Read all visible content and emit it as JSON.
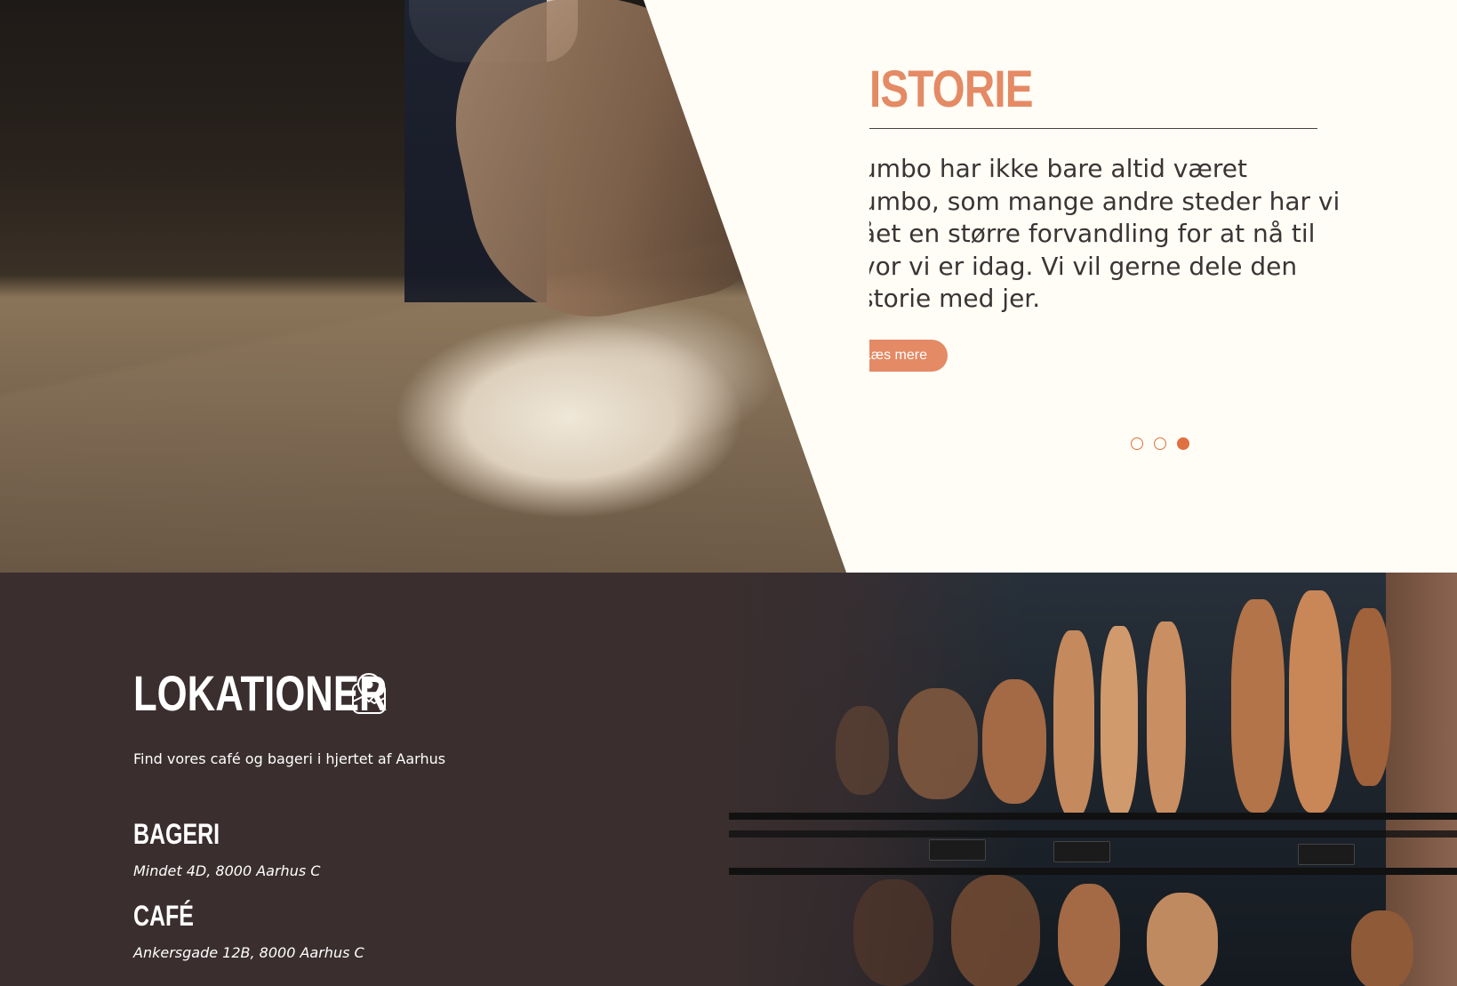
{
  "hero": {
    "title": "ISTORIE",
    "text_lines": [
      "umbo har ikke bare altid været",
      "umbo, som mange andre steder har vi",
      "ået en større forvandling for at nå til",
      "vor vi er idag. Vi vil gerne dele den",
      "storie med jer."
    ],
    "button_label": "Læs mere",
    "slider": {
      "total": 3,
      "active_index": 2
    },
    "photo_alt": "baker-with-flour-image"
  },
  "locations": {
    "title": "LOKATIONER",
    "icon": "map-pin-icon",
    "subtitle": "Find vores café og bageri i hjertet af Aarhus",
    "places": [
      {
        "name": "BAGERI",
        "address": "Mindet 4D, 8000 Aarhus C"
      },
      {
        "name": "CAFÉ",
        "address": "Ankersgade 12B, 8000 Aarhus C"
      }
    ],
    "photo_alt": "bread-shelf-image"
  },
  "colors": {
    "accent": "#e48a65",
    "dot": "#e0703f",
    "hero_bg": "#fffdf5",
    "dark_bg": "#3a2e2f",
    "text_dark": "#3a3535"
  }
}
